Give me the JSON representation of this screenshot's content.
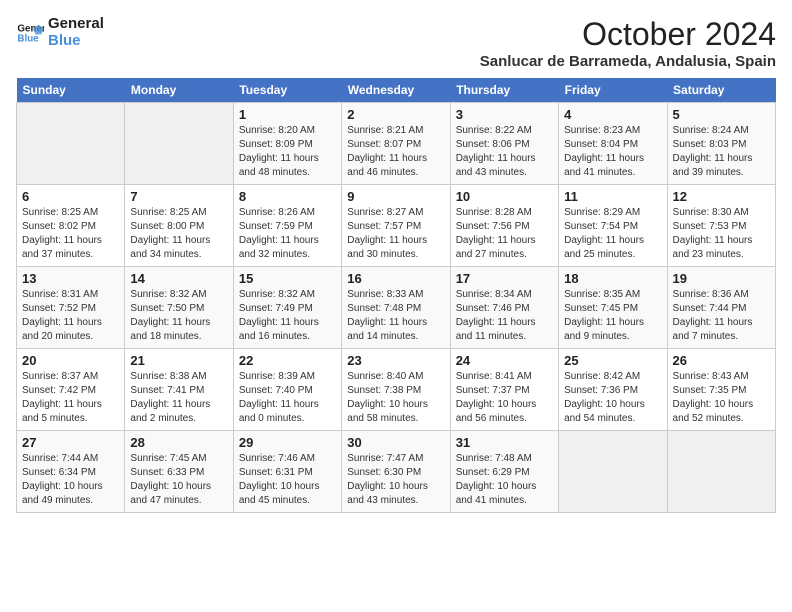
{
  "logo": {
    "line1": "General",
    "line2": "Blue"
  },
  "title": "October 2024",
  "location": "Sanlucar de Barrameda, Andalusia, Spain",
  "days_of_week": [
    "Sunday",
    "Monday",
    "Tuesday",
    "Wednesday",
    "Thursday",
    "Friday",
    "Saturday"
  ],
  "weeks": [
    [
      {
        "day": "",
        "info": ""
      },
      {
        "day": "",
        "info": ""
      },
      {
        "day": "1",
        "info": "Sunrise: 8:20 AM\nSunset: 8:09 PM\nDaylight: 11 hours and 48 minutes."
      },
      {
        "day": "2",
        "info": "Sunrise: 8:21 AM\nSunset: 8:07 PM\nDaylight: 11 hours and 46 minutes."
      },
      {
        "day": "3",
        "info": "Sunrise: 8:22 AM\nSunset: 8:06 PM\nDaylight: 11 hours and 43 minutes."
      },
      {
        "day": "4",
        "info": "Sunrise: 8:23 AM\nSunset: 8:04 PM\nDaylight: 11 hours and 41 minutes."
      },
      {
        "day": "5",
        "info": "Sunrise: 8:24 AM\nSunset: 8:03 PM\nDaylight: 11 hours and 39 minutes."
      }
    ],
    [
      {
        "day": "6",
        "info": "Sunrise: 8:25 AM\nSunset: 8:02 PM\nDaylight: 11 hours and 37 minutes."
      },
      {
        "day": "7",
        "info": "Sunrise: 8:25 AM\nSunset: 8:00 PM\nDaylight: 11 hours and 34 minutes."
      },
      {
        "day": "8",
        "info": "Sunrise: 8:26 AM\nSunset: 7:59 PM\nDaylight: 11 hours and 32 minutes."
      },
      {
        "day": "9",
        "info": "Sunrise: 8:27 AM\nSunset: 7:57 PM\nDaylight: 11 hours and 30 minutes."
      },
      {
        "day": "10",
        "info": "Sunrise: 8:28 AM\nSunset: 7:56 PM\nDaylight: 11 hours and 27 minutes."
      },
      {
        "day": "11",
        "info": "Sunrise: 8:29 AM\nSunset: 7:54 PM\nDaylight: 11 hours and 25 minutes."
      },
      {
        "day": "12",
        "info": "Sunrise: 8:30 AM\nSunset: 7:53 PM\nDaylight: 11 hours and 23 minutes."
      }
    ],
    [
      {
        "day": "13",
        "info": "Sunrise: 8:31 AM\nSunset: 7:52 PM\nDaylight: 11 hours and 20 minutes."
      },
      {
        "day": "14",
        "info": "Sunrise: 8:32 AM\nSunset: 7:50 PM\nDaylight: 11 hours and 18 minutes."
      },
      {
        "day": "15",
        "info": "Sunrise: 8:32 AM\nSunset: 7:49 PM\nDaylight: 11 hours and 16 minutes."
      },
      {
        "day": "16",
        "info": "Sunrise: 8:33 AM\nSunset: 7:48 PM\nDaylight: 11 hours and 14 minutes."
      },
      {
        "day": "17",
        "info": "Sunrise: 8:34 AM\nSunset: 7:46 PM\nDaylight: 11 hours and 11 minutes."
      },
      {
        "day": "18",
        "info": "Sunrise: 8:35 AM\nSunset: 7:45 PM\nDaylight: 11 hours and 9 minutes."
      },
      {
        "day": "19",
        "info": "Sunrise: 8:36 AM\nSunset: 7:44 PM\nDaylight: 11 hours and 7 minutes."
      }
    ],
    [
      {
        "day": "20",
        "info": "Sunrise: 8:37 AM\nSunset: 7:42 PM\nDaylight: 11 hours and 5 minutes."
      },
      {
        "day": "21",
        "info": "Sunrise: 8:38 AM\nSunset: 7:41 PM\nDaylight: 11 hours and 2 minutes."
      },
      {
        "day": "22",
        "info": "Sunrise: 8:39 AM\nSunset: 7:40 PM\nDaylight: 11 hours and 0 minutes."
      },
      {
        "day": "23",
        "info": "Sunrise: 8:40 AM\nSunset: 7:38 PM\nDaylight: 10 hours and 58 minutes."
      },
      {
        "day": "24",
        "info": "Sunrise: 8:41 AM\nSunset: 7:37 PM\nDaylight: 10 hours and 56 minutes."
      },
      {
        "day": "25",
        "info": "Sunrise: 8:42 AM\nSunset: 7:36 PM\nDaylight: 10 hours and 54 minutes."
      },
      {
        "day": "26",
        "info": "Sunrise: 8:43 AM\nSunset: 7:35 PM\nDaylight: 10 hours and 52 minutes."
      }
    ],
    [
      {
        "day": "27",
        "info": "Sunrise: 7:44 AM\nSunset: 6:34 PM\nDaylight: 10 hours and 49 minutes."
      },
      {
        "day": "28",
        "info": "Sunrise: 7:45 AM\nSunset: 6:33 PM\nDaylight: 10 hours and 47 minutes."
      },
      {
        "day": "29",
        "info": "Sunrise: 7:46 AM\nSunset: 6:31 PM\nDaylight: 10 hours and 45 minutes."
      },
      {
        "day": "30",
        "info": "Sunrise: 7:47 AM\nSunset: 6:30 PM\nDaylight: 10 hours and 43 minutes."
      },
      {
        "day": "31",
        "info": "Sunrise: 7:48 AM\nSunset: 6:29 PM\nDaylight: 10 hours and 41 minutes."
      },
      {
        "day": "",
        "info": ""
      },
      {
        "day": "",
        "info": ""
      }
    ]
  ]
}
